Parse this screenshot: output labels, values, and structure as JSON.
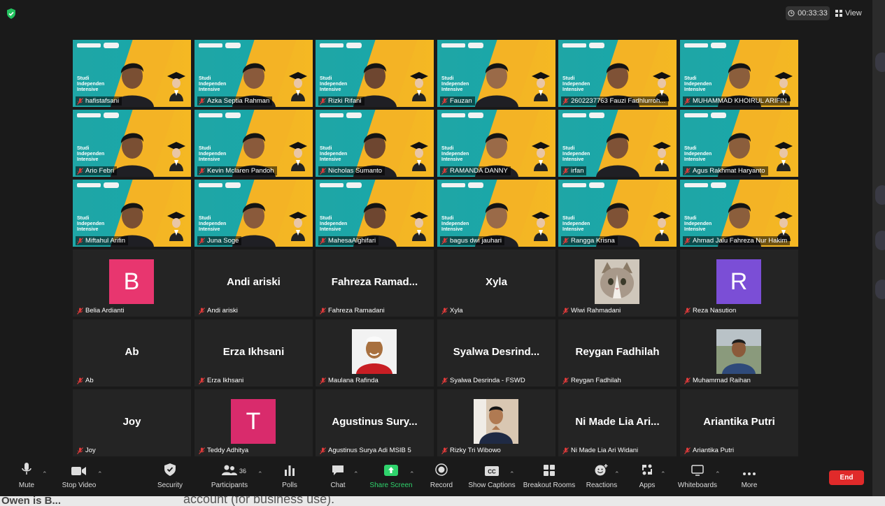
{
  "meeting": {
    "timer": "00:33:33",
    "view_label": "View",
    "end_label": "End"
  },
  "video_tiles": [
    {
      "name": "hafistafsani"
    },
    {
      "name": "Azka Septia Rahman"
    },
    {
      "name": "Rizki Rifani"
    },
    {
      "name": "Fauzan"
    },
    {
      "name": "2602237763 Fauzi Fadhlurroh..."
    },
    {
      "name": "MUHAMMAD KHOIRUL ARIFIN"
    },
    {
      "name": "Ario Febri"
    },
    {
      "name": "Kevin Mclaren Pandoh"
    },
    {
      "name": "Nicholas Sumanto"
    },
    {
      "name": "RAMANDA DANNY"
    },
    {
      "name": "irfan"
    },
    {
      "name": "Agus Rakhmat Haryanto"
    },
    {
      "name": "Miftahul Arifin"
    },
    {
      "name": "Juna Soge"
    },
    {
      "name": "MahesaAlghifari"
    },
    {
      "name": "bagus dwi jauhari"
    },
    {
      "name": "Rangga Krisna"
    },
    {
      "name": "Ahmad Jalu Fahreza Nur Hakim"
    }
  ],
  "background_text": {
    "line1": "Studi",
    "line2": "Independen",
    "line3": "Intensive"
  },
  "camera_off_tiles": [
    {
      "name": "Belia Ardianti",
      "center": "",
      "avatar_letter": "B",
      "avatar_color": "#e8366f"
    },
    {
      "name": "Andi ariski",
      "center": "Andi ariski"
    },
    {
      "name": "Fahreza Ramadani",
      "center": "Fahreza  Ramad..."
    },
    {
      "name": "Xyla",
      "center": "Xyla"
    },
    {
      "name": "Wiwi Rahmadani",
      "center": "",
      "photo": "cat"
    },
    {
      "name": "Reza Nasution",
      "center": "",
      "avatar_letter": "R",
      "avatar_color": "#7b4ed6"
    },
    {
      "name": "Ab",
      "center": "Ab"
    },
    {
      "name": "Erza Ikhsani",
      "center": "Erza Ikhsani"
    },
    {
      "name": "Maulana Rafinda",
      "center": "",
      "photo": "man-red"
    },
    {
      "name": "Syalwa Desrinda - FSWD",
      "center": "Syalwa  Desrind..."
    },
    {
      "name": "Reygan Fadhilah",
      "center": "Reygan Fadhilah"
    },
    {
      "name": "Muhammad Raihan",
      "center": "",
      "photo": "man-outdoor"
    },
    {
      "name": "Joy",
      "center": "Joy"
    },
    {
      "name": "Teddy Adhitya",
      "center": "",
      "avatar_letter": "T",
      "avatar_color": "#d92b6c"
    },
    {
      "name": "Agustinus Surya Adi MSIB 5",
      "center": "Agustinus Sury..."
    },
    {
      "name": "Rizky Tri Wibowo",
      "center": "",
      "photo": "man-pray"
    },
    {
      "name": "Ni Made Lia Ari Widani",
      "center": "Ni Made Lia Ari..."
    },
    {
      "name": "Ariantika Putri",
      "center": "Ariantika Putri"
    }
  ],
  "toolbar": {
    "mute": "Mute",
    "stop_video": "Stop Video",
    "security": "Security",
    "participants": "Participants",
    "participants_count": "36",
    "polls": "Polls",
    "chat": "Chat",
    "share_screen": "Share Screen",
    "record": "Record",
    "show_captions": "Show Captions",
    "breakout_rooms": "Breakout Rooms",
    "reactions": "Reactions",
    "apps": "Apps",
    "whiteboards": "Whiteboards",
    "more": "More"
  },
  "background_peek": {
    "left_text": "Owen is B...",
    "text": "account (for business use)."
  },
  "colors": {
    "accent_green": "#2fd36c",
    "end_red": "#e02a2a",
    "active_speaker": "#cce246"
  }
}
